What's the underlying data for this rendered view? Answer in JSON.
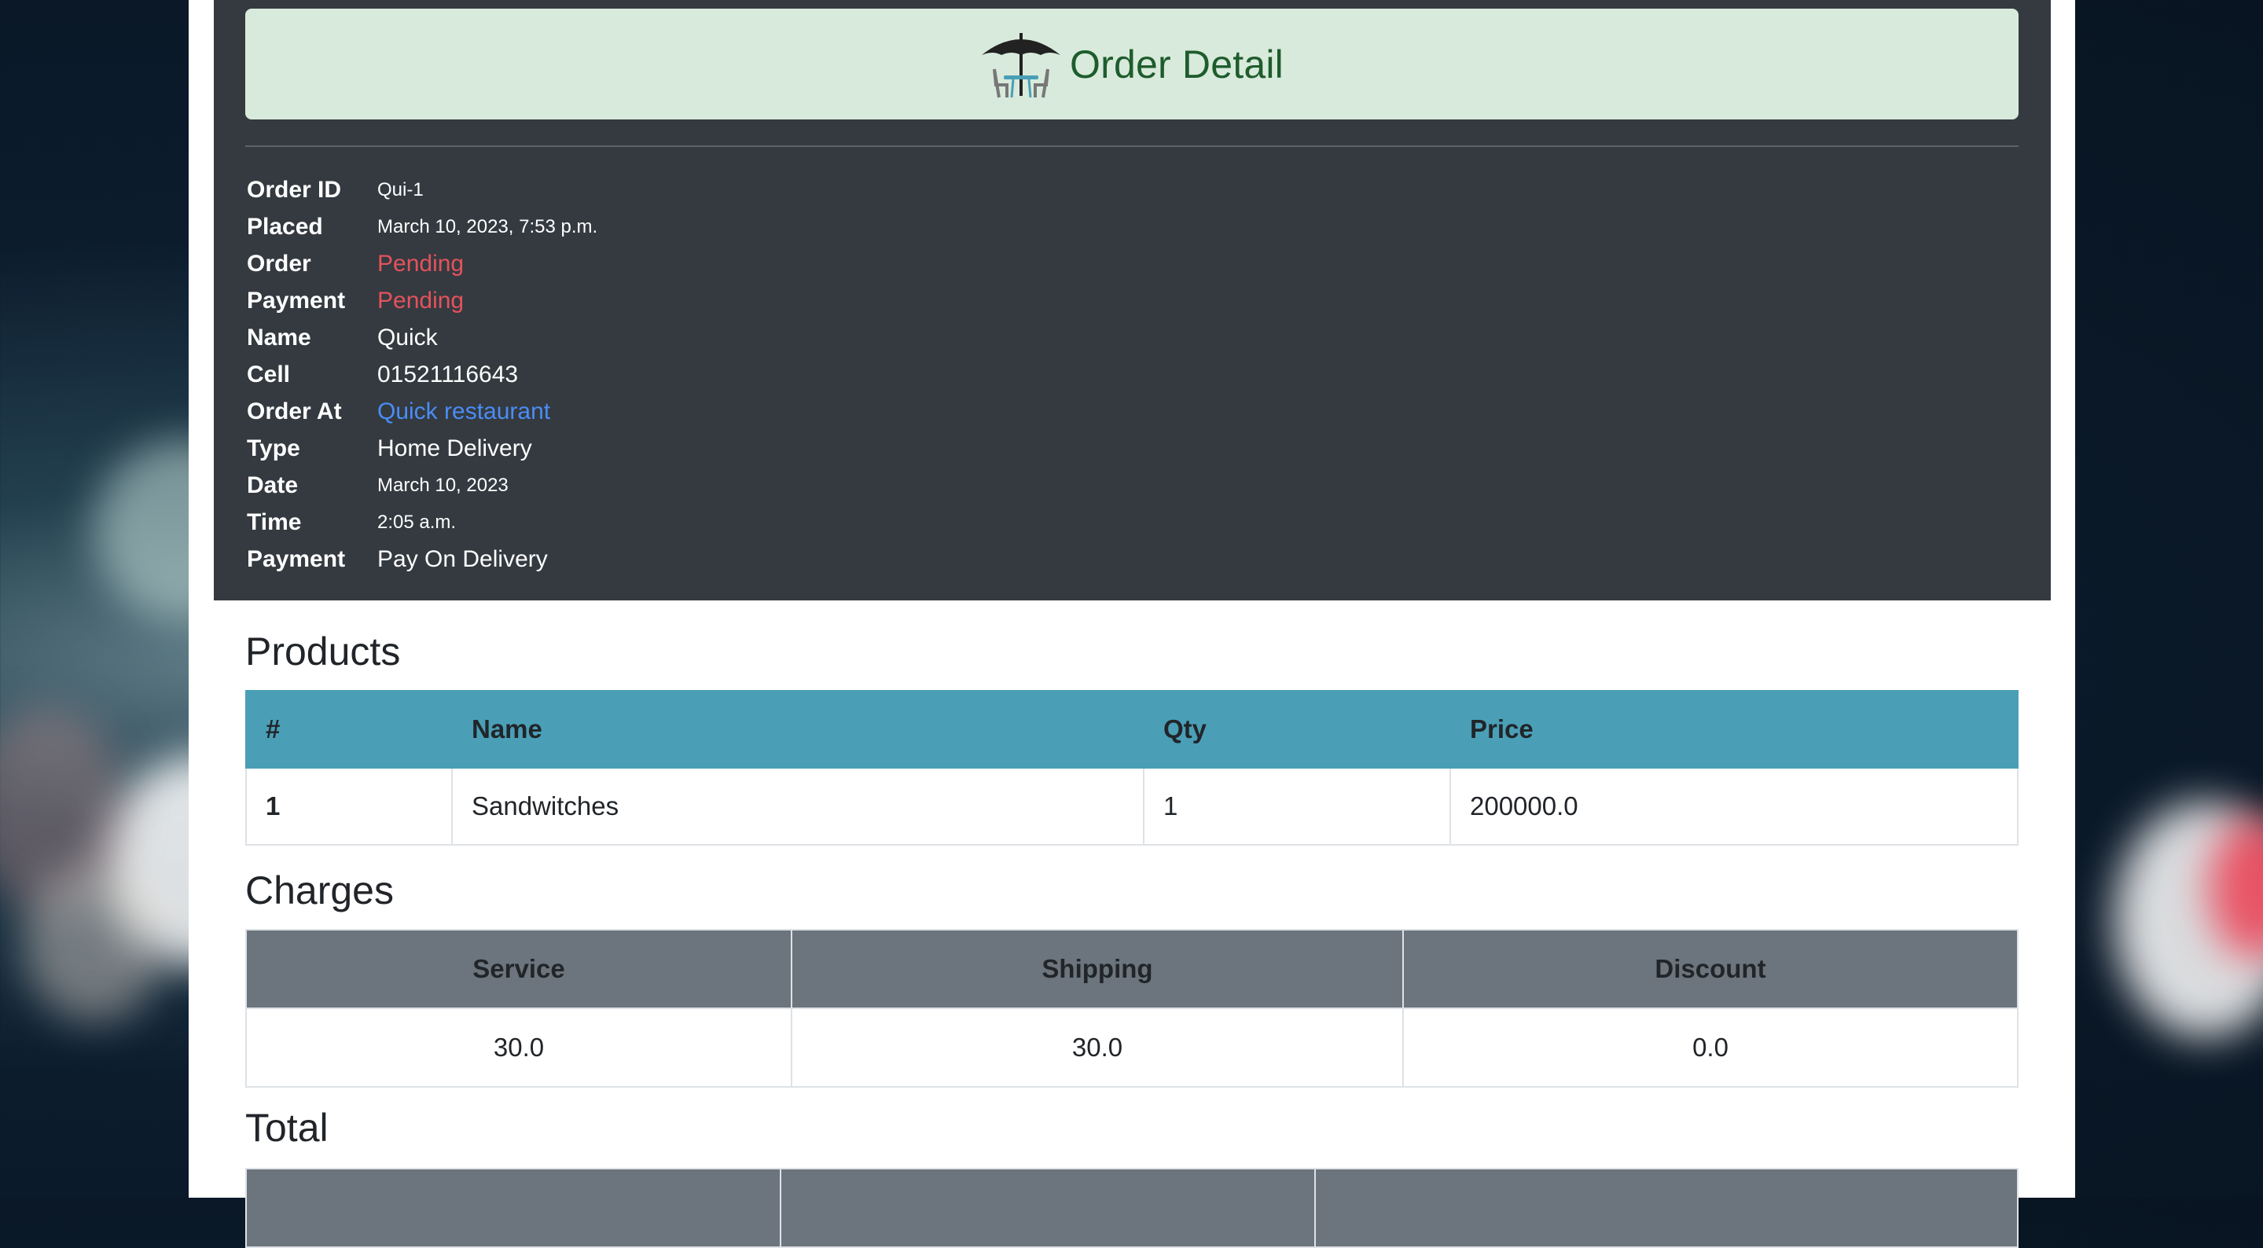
{
  "header": {
    "title": "Order Detail",
    "icon": "umbrella-table-icon"
  },
  "order_info": [
    {
      "label": "Order ID",
      "value": "Qui-1"
    },
    {
      "label": "Placed",
      "value": "March 10, 2023, 7:53 p.m."
    },
    {
      "label": "Order",
      "value": "Pending"
    },
    {
      "label": "Payment",
      "value": "Pending"
    },
    {
      "label": "Name",
      "value": "Quick"
    },
    {
      "label": "Cell",
      "value": "01521116643"
    },
    {
      "label": "Order At",
      "value": "Quick restaurant"
    },
    {
      "label": "Type",
      "value": "Home Delivery"
    },
    {
      "label": "Date",
      "value": "March 10, 2023"
    },
    {
      "label": "Time",
      "value": "2:05 a.m."
    },
    {
      "label": "Payment",
      "value": "Pay On Delivery"
    }
  ],
  "products": {
    "heading": "Products",
    "columns": [
      "#",
      "Name",
      "Qty",
      "Price"
    ],
    "rows": [
      [
        "1",
        "Sandwitches",
        "1",
        "200000.0"
      ]
    ]
  },
  "charges": {
    "heading": "Charges",
    "columns": [
      "Service",
      "Shipping",
      "Discount"
    ],
    "values": [
      "30.0",
      "30.0",
      "0.0"
    ]
  },
  "total": {
    "heading": "Total"
  },
  "colors": {
    "header_bg": "#d8eadc",
    "header_text": "#1e5c2c",
    "dark_panel": "#343a40",
    "status_pending": "#e4525c",
    "link": "#4a8df5",
    "products_header": "#4a9fb7",
    "charges_header": "#6c757d"
  }
}
